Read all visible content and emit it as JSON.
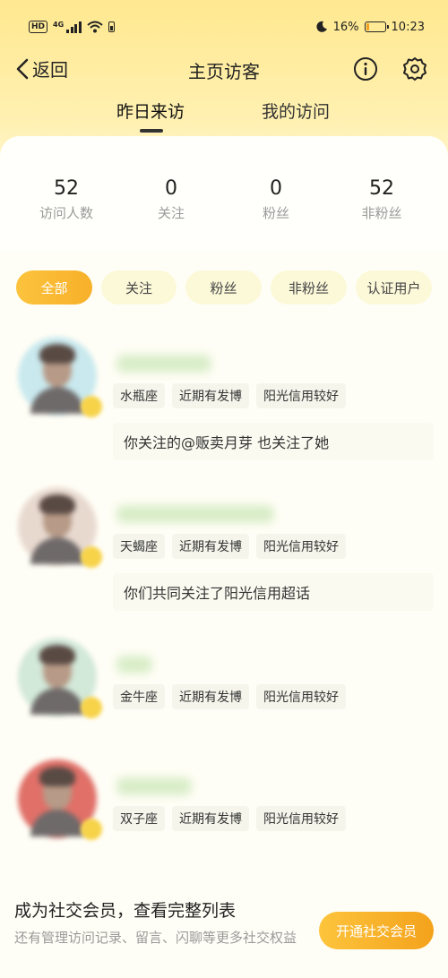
{
  "status_bar": {
    "hd": "HD",
    "network": "4G",
    "battery_percent": "16%",
    "battery_level": 0.16,
    "time": "10:23"
  },
  "header": {
    "back_label": "返回",
    "title": "主页访客"
  },
  "tabs": [
    {
      "label": "昨日来访",
      "active": true
    },
    {
      "label": "我的访问",
      "active": false
    }
  ],
  "stats": [
    {
      "value": "52",
      "label": "访问人数"
    },
    {
      "value": "0",
      "label": "关注"
    },
    {
      "value": "0",
      "label": "粉丝"
    },
    {
      "value": "52",
      "label": "非粉丝"
    }
  ],
  "filters": [
    {
      "label": "全部",
      "active": true
    },
    {
      "label": "关注",
      "active": false
    },
    {
      "label": "粉丝",
      "active": false
    },
    {
      "label": "非粉丝",
      "active": false
    },
    {
      "label": "认证用户",
      "active": false
    }
  ],
  "visitors": [
    {
      "tags": [
        "水瓶座",
        "近期有发博",
        "阳光信用较好"
      ],
      "mutual": "你关注的@贩卖月芽 也关注了她",
      "avatar_color": "#c9e9ee"
    },
    {
      "tags": [
        "天蝎座",
        "近期有发博",
        "阳光信用较好"
      ],
      "mutual": "你们共同关注了阳光信用超话",
      "avatar_color": "#e8d9cf"
    },
    {
      "tags": [
        "金牛座",
        "近期有发博",
        "阳光信用较好"
      ],
      "mutual": "",
      "avatar_color": "#d2e8d8"
    },
    {
      "tags": [
        "双子座",
        "近期有发博",
        "阳光信用较好"
      ],
      "mutual": "",
      "avatar_color": "#e07068"
    }
  ],
  "promo": {
    "title": "成为社交会员，查看完整列表",
    "subtitle": "还有管理访问记录、留言、闪聊等更多社交权益",
    "button": "开通社交会员"
  },
  "colors": {
    "accent": "#f8b02a",
    "header_bg": "#ffe88f",
    "chip_bg": "#fcf9d9"
  }
}
